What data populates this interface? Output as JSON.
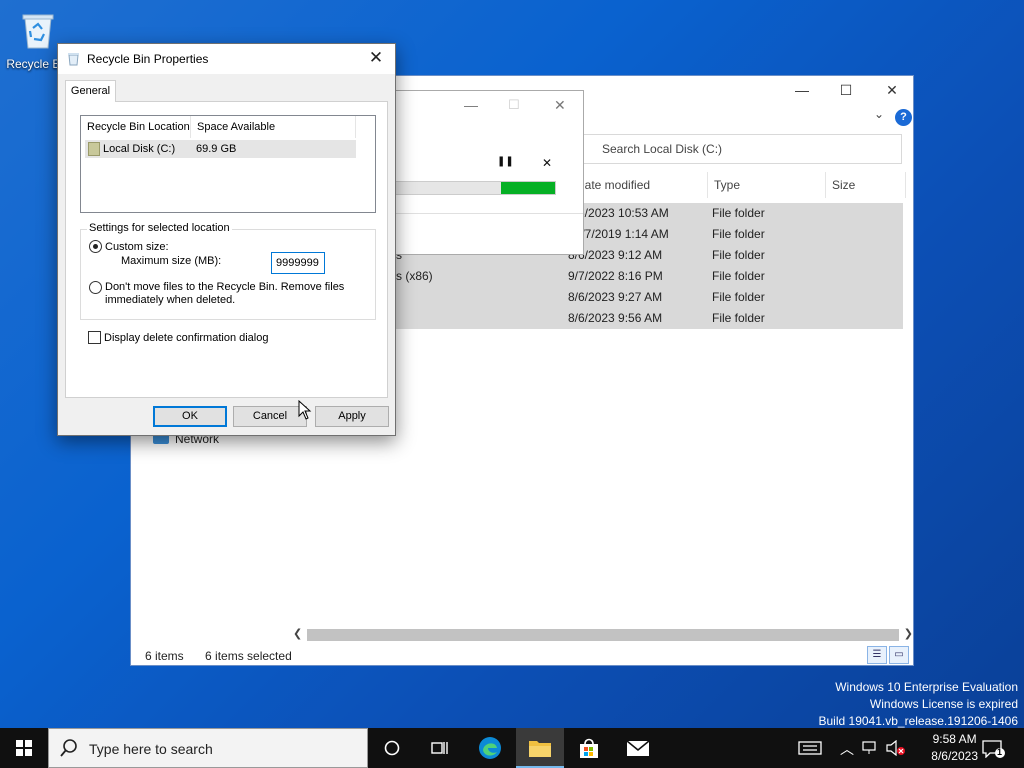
{
  "desktop": {
    "recycle_bin_label": "Recycle Bin"
  },
  "explorer": {
    "controls": {
      "minimize": "—",
      "maximize": "☐",
      "close": "✕"
    },
    "search_placeholder": "Search Local Disk (C:)",
    "columns": {
      "date": "Date modified",
      "type": "Type",
      "size": "Size"
    },
    "rows": [
      {
        "name": "",
        "date": "8/6/2023 10:53 AM",
        "type": "File folder"
      },
      {
        "name": "",
        "date": "12/7/2019 1:14 AM",
        "type": "File folder"
      },
      {
        "name": "s",
        "date": "8/6/2023 9:12 AM",
        "type": "File folder"
      },
      {
        "name": "s (x86)",
        "date": "9/7/2022 8:16 PM",
        "type": "File folder"
      },
      {
        "name": "",
        "date": "8/6/2023 9:27 AM",
        "type": "File folder"
      },
      {
        "name": "",
        "date": "8/6/2023 9:56 AM",
        "type": "File folder"
      }
    ],
    "nav_network": "Network",
    "status_items": "6 items",
    "status_selected": "6 items selected"
  },
  "progress_dialog": {
    "pause": "❚❚",
    "cancel": "✕",
    "progress_fraction": 0.34
  },
  "properties": {
    "title": "Recycle Bin Properties",
    "tab_general": "General",
    "list": {
      "col_location": "Recycle Bin Location",
      "col_space": "Space Available",
      "row_location": "Local Disk (C:)",
      "row_space": "69.9 GB"
    },
    "group_label": "Settings for selected location",
    "custom_size_label": "Custom size:",
    "max_size_label": "Maximum size (MB):",
    "max_size_value": "9999999",
    "dont_move_line1": "Don't move files to the Recycle Bin. Remove files",
    "dont_move_line2": "immediately when deleted.",
    "confirm_dialog_label": "Display delete confirmation dialog",
    "custom_size_selected": true,
    "confirm_checked": false,
    "buttons": {
      "ok": "OK",
      "cancel": "Cancel",
      "apply": "Apply"
    }
  },
  "watermark": {
    "line1": "Windows 10 Enterprise Evaluation",
    "line2": "Windows License is expired",
    "line3": "Build 19041.vb_release.191206-1406"
  },
  "taskbar": {
    "search_placeholder": "Type here to search",
    "time": "9:58 AM",
    "date": "8/6/2023",
    "notification_count": "1"
  }
}
